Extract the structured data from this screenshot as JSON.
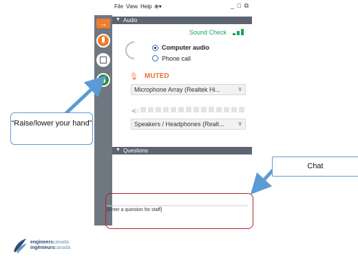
{
  "menu": {
    "file": "File",
    "view": "View",
    "help": "Help",
    "globe": "⊕▾",
    "window_controls": "_ □ ⧉"
  },
  "audio": {
    "header": "Audio",
    "sound_check": "Sound Check",
    "options": [
      "Computer audio",
      "Phone call"
    ],
    "selected": "Computer audio",
    "status": "MUTED",
    "microphone": "Microphone Array (Realtek Hi...",
    "speakers": "Speakers / Headphones (Realt..."
  },
  "questions": {
    "header": "Questions",
    "input_placeholder": "[Enter a question for staff]"
  },
  "callouts": {
    "raise_hand": "“Raise/lower your hand”",
    "chat": "Chat"
  },
  "logo": {
    "line1_bold": "engineers",
    "line1_light": "canada",
    "line2_bold": "ingénieurs",
    "line2_light": "canada"
  },
  "colors": {
    "accent_orange": "#f07d2d",
    "sound_check_green": "#18a35a",
    "highlight_red": "#b3202a",
    "callout_blue": "#5b9bd5"
  },
  "icons": [
    "arrow-right-icon",
    "microphone-icon",
    "panel-icon",
    "raise-hand-icon",
    "headset-icon",
    "speaker-icon",
    "chevron-down-icon",
    "globe-icon"
  ]
}
